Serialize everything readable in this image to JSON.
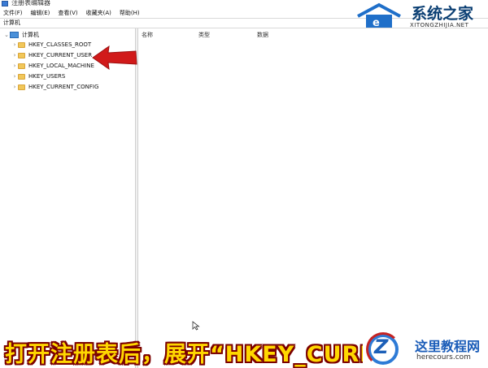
{
  "window": {
    "title": "注册表编辑器"
  },
  "menu": [
    "文件(F)",
    "编辑(E)",
    "查看(V)",
    "收藏夹(A)",
    "帮助(H)"
  ],
  "address": "计算机",
  "tree": {
    "root": "计算机",
    "keys": [
      "HKEY_CLASSES_ROOT",
      "HKEY_CURRENT_USER",
      "HKEY_LOCAL_MACHINE",
      "HKEY_USERS",
      "HKEY_CURRENT_CONFIG"
    ]
  },
  "list_columns": [
    "名称",
    "类型",
    "数据"
  ],
  "watermark_top": {
    "name": "系统之家",
    "url": "XITONGZHIJIA.NET"
  },
  "caption": "打开注册表后，展开“HKEY_CURRE",
  "watermark_bottom": {
    "title": "这里教程网",
    "url": "herecours.com"
  },
  "colors": {
    "arrow": "#d11a1a",
    "caption_fill": "#ffd700",
    "caption_outline": "#7a0000"
  }
}
